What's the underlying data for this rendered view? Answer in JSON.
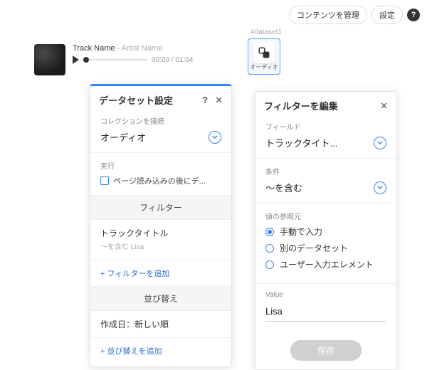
{
  "top": {
    "manage": "コンテンツを管理",
    "settings": "設定",
    "help": "?"
  },
  "player": {
    "track": "Track Name",
    "sep": "  -  ",
    "artist": "Artist Name",
    "time_current": "00:00",
    "time_sep": " / ",
    "time_total": "01:04"
  },
  "dataset": {
    "id": "#dataset1",
    "label": "オーディオ"
  },
  "ds_panel": {
    "title": "データセット設定",
    "help": "?",
    "close": "✕",
    "collection_label": "コレクションを接続",
    "collection_value": "オーディオ",
    "run_label": "実行",
    "run_option": "ページ読み込みの後にデ...",
    "filter_head": "フィルター",
    "filter_item": "トラックタイトル",
    "filter_sub": "〜を含む Lisa",
    "add_filter": "+ フィルターを追加",
    "sort_head": "並び替え",
    "sort_item": "作成日：新しい順",
    "add_sort": "+ 並び替えを追加"
  },
  "filter_panel": {
    "title": "フィルターを編集",
    "close": "✕",
    "field_label": "フィールド",
    "field_value": "トラックタイト...",
    "cond_label": "条件",
    "cond_value": "〜を含む",
    "source_label": "値の参照元",
    "opt_manual": "手動で入力",
    "opt_dataset": "別のデータセット",
    "opt_user": "ユーザー入力エレメント",
    "value_label": "Value",
    "value": "Lisa",
    "save": "保存"
  }
}
